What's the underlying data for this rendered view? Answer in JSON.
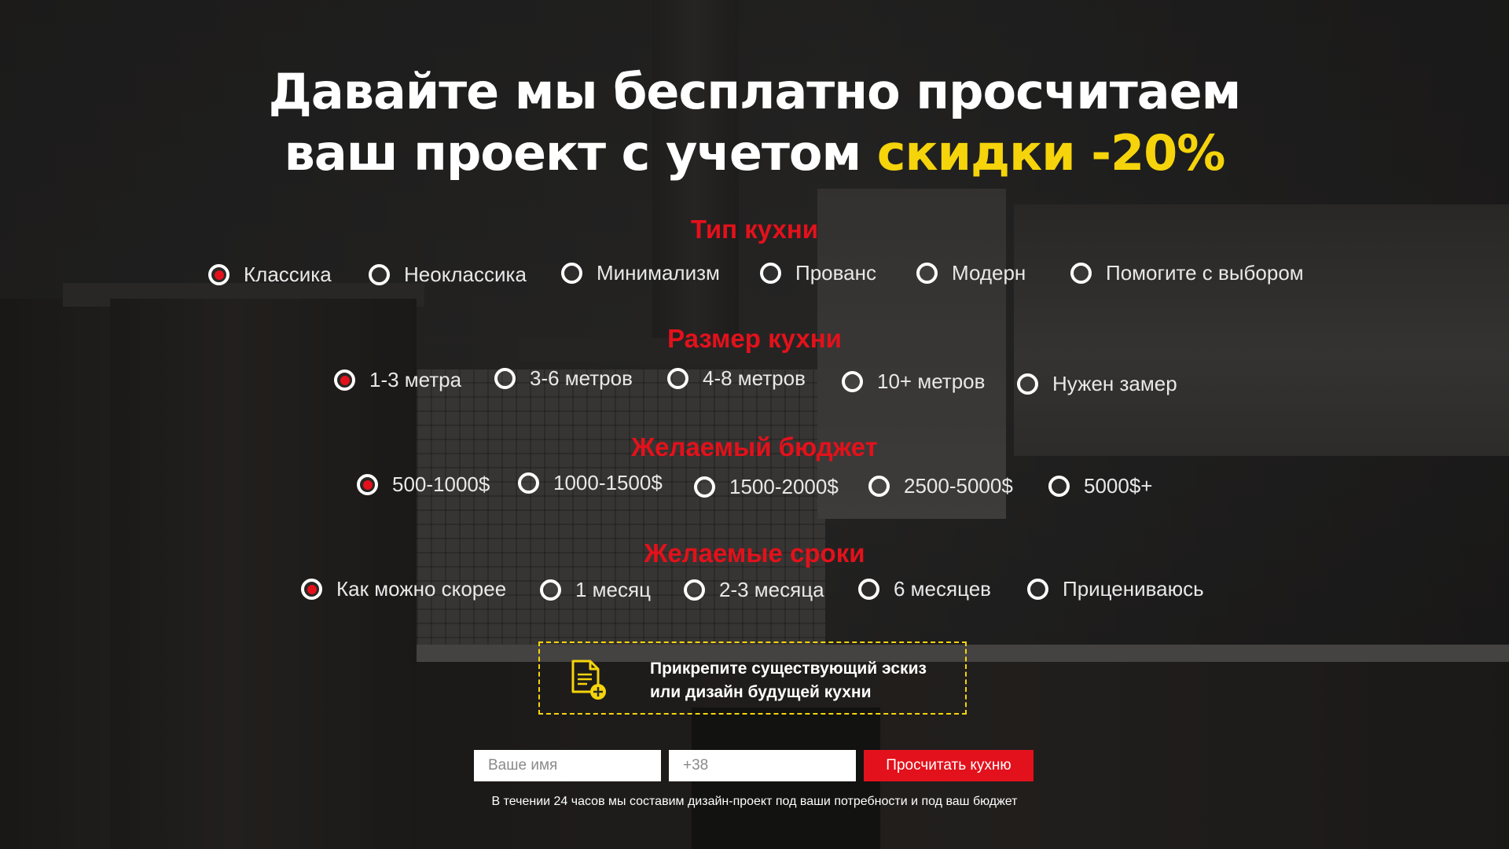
{
  "headline": {
    "line1": "Давайте мы бесплатно просчитаем",
    "line2_prefix": "ваш проект с учетом ",
    "line2_accent": "скидки -20%"
  },
  "colors": {
    "accent_yellow": "#f5d40b",
    "accent_red": "#e3111b",
    "text_white": "#ffffff"
  },
  "sections": {
    "kitchen_type": {
      "title": "Тип кухни",
      "selected": "Классика",
      "options": [
        "Классика",
        "Неоклассика",
        "Минимализм",
        "Прованс",
        "Модерн",
        "Помогите с выбором"
      ]
    },
    "kitchen_size": {
      "title": "Размер кухни",
      "selected": "1-3 метра",
      "options": [
        "1-3 метра",
        "3-6 метров",
        "4-8 метров",
        "10+ метров",
        "Нужен замер"
      ]
    },
    "budget": {
      "title": "Желаемый бюджет",
      "selected": "500-1000$",
      "options": [
        "500-1000$",
        "1000-1500$",
        "1500-2000$",
        "2500-5000$",
        "5000$+"
      ]
    },
    "timeline": {
      "title": "Желаемые сроки",
      "selected": "Как можно скорее",
      "options": [
        "Как можно скорее",
        "1 месяц",
        "2-3 месяца",
        "6 месяцев",
        "Прицениваюсь"
      ]
    }
  },
  "attach": {
    "line1": "Прикрепите существующий эскиз",
    "line2": "или дизайн будущей кухни",
    "icon": "file-add-icon"
  },
  "form": {
    "name_placeholder": "Ваше имя",
    "phone_placeholder": "+38",
    "submit_label": "Просчитать кухню"
  },
  "note": "В течении 24 часов мы составим дизайн-проект под ваши потребности и под ваш бюджет"
}
